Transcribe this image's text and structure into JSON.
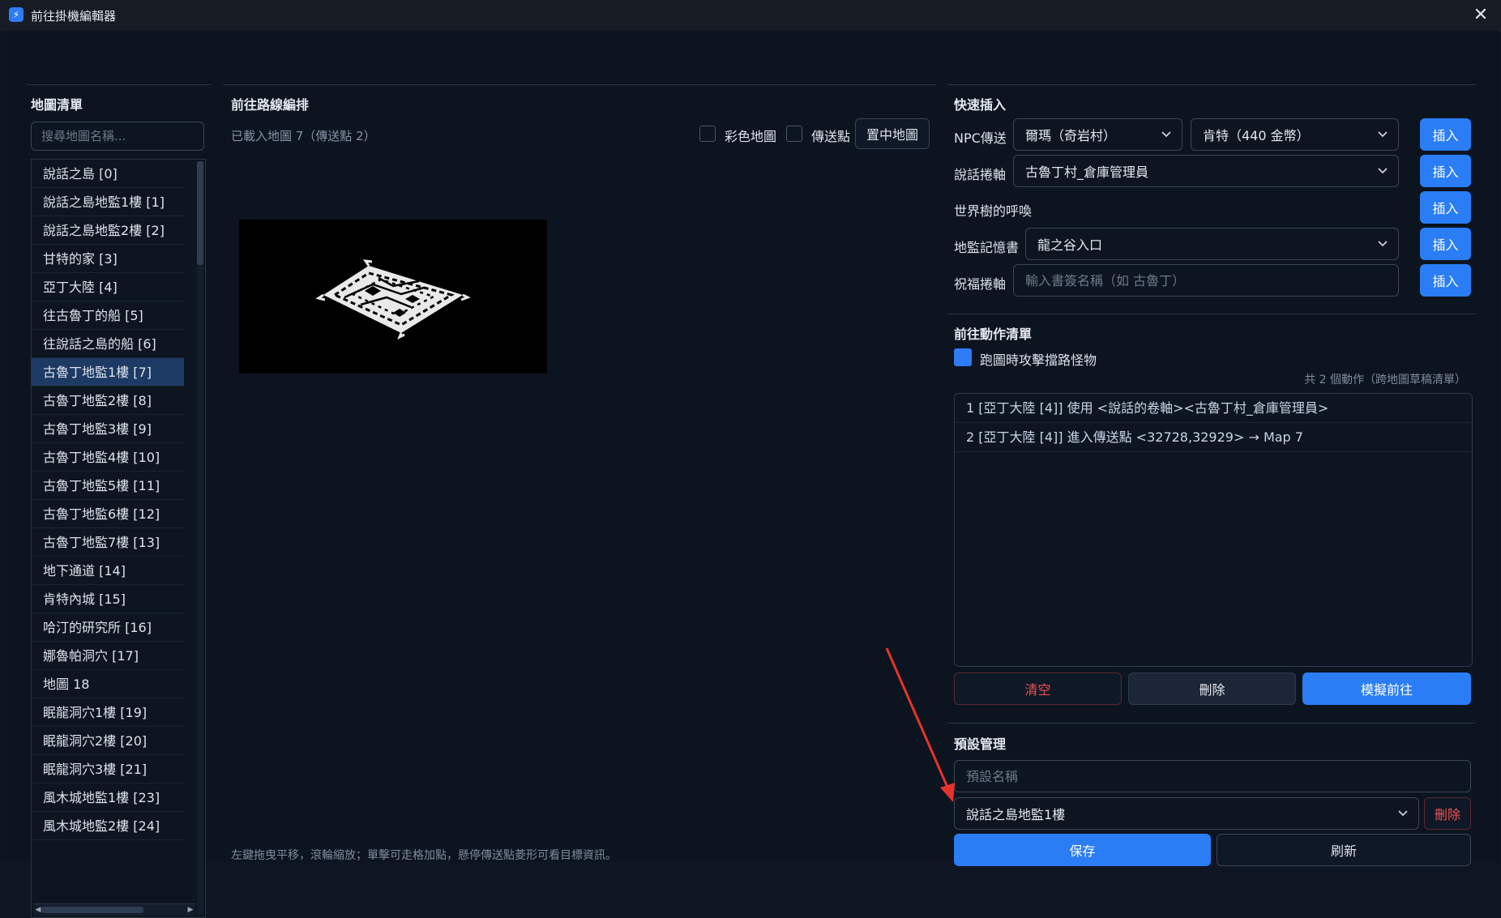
{
  "window": {
    "title": "前往掛機編輯器",
    "icon": "lightning-icon"
  },
  "left": {
    "title": "地圖清單",
    "search_placeholder": "搜尋地圖名稱...",
    "maps": [
      "說話之島 [0]",
      "說話之島地監1樓 [1]",
      "說話之島地監2樓 [2]",
      "甘特的家 [3]",
      "亞丁大陸 [4]",
      "往古魯丁的船 [5]",
      "往說話之島的船 [6]",
      "古魯丁地監1樓 [7]",
      "古魯丁地監2樓 [8]",
      "古魯丁地監3樓 [9]",
      "古魯丁地監4樓 [10]",
      "古魯丁地監5樓 [11]",
      "古魯丁地監6樓 [12]",
      "古魯丁地監7樓 [13]",
      "地下通道 [14]",
      "肯特內城 [15]",
      "哈汀的研究所 [16]",
      "娜魯帕洞穴 [17]",
      "地圖 18",
      "眠龍洞穴1樓 [19]",
      "眠龍洞穴2樓 [20]",
      "眠龍洞穴3樓 [21]",
      "風木城地監1樓 [23]",
      "風木城地監2樓 [24]"
    ],
    "selected_index": 7
  },
  "middle": {
    "title": "前往路線編排",
    "loaded_text": "已載入地圖 7（傳送點 2）",
    "color_map_label": "彩色地圖",
    "teleport_label": "傳送點",
    "center_button": "置中地圖",
    "hint": "左鍵拖曳平移，滾輪縮放；單擊可走格加點，懸停傳送點菱形可看目標資訊。"
  },
  "right": {
    "quick_insert_title": "快速插入",
    "insert_label": "插入",
    "npc_label": "NPC傳送",
    "npc_value": "爾瑪（奇岩村）",
    "npc_target_value": "肯特（440 金幣）",
    "scroll_label": "說話捲軸",
    "scroll_value": "古魯丁村_倉庫管理員",
    "tree_label": "世界樹的呼喚",
    "memory_label": "地監記憶書",
    "memory_value": "龍之谷入口",
    "bless_label": "祝福捲軸",
    "bless_placeholder": "輸入書簽名稱（如 古魯丁）",
    "action_title": "前往動作清單",
    "attack_label": "跑圖時攻擊擋路怪物",
    "action_count": "共 2 個動作（跨地圖草稿清單）",
    "actions": [
      "1  [亞丁大陸 [4]]  使用 <說話的卷軸><古魯丁村_倉庫管理員>",
      "2  [亞丁大陸 [4]]  進入傳送點 <32728,32929> → Map 7"
    ],
    "clear_label": "清空",
    "delete_label": "刪除",
    "simulate_label": "模擬前往",
    "preset_title": "預設管理",
    "preset_name_placeholder": "預設名稱",
    "preset_value": "說話之島地監1樓",
    "preset_delete_label": "刪除",
    "save_label": "保存",
    "refresh_label": "刷新"
  },
  "colors": {
    "accent": "#2a7df5",
    "danger": "#f05252",
    "annotation_arrow": "#e8322c"
  }
}
